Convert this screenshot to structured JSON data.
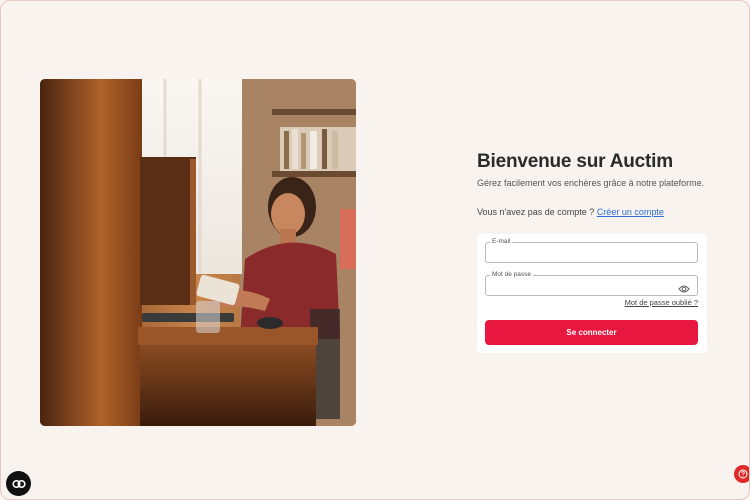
{
  "welcome": {
    "title": "Bienvenue sur Auctim",
    "subtitle": "Gérez facilement vos enchères grâce à notre plateforme."
  },
  "signup": {
    "prompt": "Vous n'avez pas de compte ?",
    "link": "Créer un compte"
  },
  "form": {
    "email_label": "E-mail",
    "email_value": "",
    "password_label": "Mot de passe",
    "password_value": "",
    "forgot_link": "Mot de passe oublié ?",
    "submit_label": "Se connecter"
  },
  "icons": {
    "password_toggle": "eye-icon",
    "left_fab": "accessibility-icon",
    "right_fab": "help-icon"
  },
  "colors": {
    "accent": "#e8173f",
    "link": "#2f6fd6",
    "page_bg": "#f8f3ef"
  }
}
